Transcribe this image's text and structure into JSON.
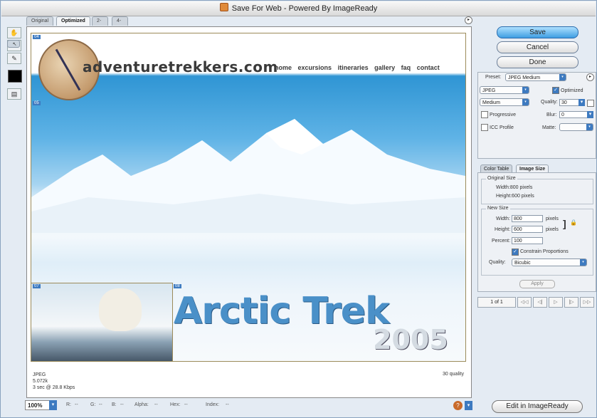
{
  "window": {
    "title": "Save For Web - Powered By ImageReady"
  },
  "view_tabs": [
    "Original",
    "Optimized",
    "2-Up",
    "4-Up"
  ],
  "active_view_tab": "Optimized",
  "tools": [
    {
      "name": "hand-tool-icon",
      "glyph": "✋"
    },
    {
      "name": "slice-select-tool-icon",
      "glyph": "↖"
    },
    {
      "name": "zoom-tool-icon",
      "glyph": "🔍"
    },
    {
      "name": "eyedropper-tool-icon",
      "glyph": "✎"
    }
  ],
  "eyedropper_color": "#000000",
  "canvas": {
    "site_name": "adventuretrekkers.com",
    "nav": [
      "home",
      "excursions",
      "itineraries",
      "gallery",
      "faq",
      "contact"
    ],
    "headline": "Arctic Trek",
    "year": "2005",
    "slice_labels": [
      "04",
      "05",
      "07",
      "08"
    ]
  },
  "doc_info": {
    "format": "JPEG",
    "size": "5.072k",
    "download_time": "3 sec @ 28.8 Kbps",
    "quality_note": "30 quality"
  },
  "statusbar": {
    "zoom": "100%",
    "r": "R:",
    "r_val": "--",
    "g": "G:",
    "g_val": "--",
    "b": "B:",
    "b_val": "--",
    "alpha": "Alpha:",
    "alpha_val": "--",
    "hex": "Hex:",
    "hex_val": "--",
    "index": "Index:",
    "index_val": "--"
  },
  "buttons": {
    "save": "Save",
    "cancel": "Cancel",
    "done": "Done",
    "edit_in_imageready": "Edit in ImageReady",
    "apply": "Apply"
  },
  "settings": {
    "preset_label": "Preset:",
    "preset_value": "JPEG Medium",
    "format_value": "JPEG",
    "optimized_label": "Optimized",
    "optimized_checked": true,
    "compression_value": "Medium",
    "quality_label": "Quality:",
    "quality_value": "30",
    "progressive_label": "Progressive",
    "progressive_checked": false,
    "blur_label": "Blur:",
    "blur_value": "0",
    "icc_label": "ICC Profile",
    "icc_checked": false,
    "matte_label": "Matte:",
    "matte_value": ""
  },
  "right_tabs": [
    "Color Table",
    "Image Size"
  ],
  "active_right_tab": "Image Size",
  "image_size": {
    "original_title": "Original Size",
    "orig_width": "Width:800 pixels",
    "orig_height": "Height:600 pixels",
    "new_title": "New Size",
    "width_label": "Width:",
    "width_value": "800",
    "height_label": "Height:",
    "height_value": "600",
    "unit": "pixels",
    "percent_label": "Percent:",
    "percent_value": "100",
    "constrain_label": "Constrain Proportions",
    "constrain_checked": true,
    "quality_label": "Quality:",
    "quality_value": "Bicubic"
  },
  "animation": {
    "frame_count": "1 of 1",
    "controls": [
      "◁◁",
      "◁|",
      "▷",
      "|▷",
      "▷▷"
    ]
  },
  "colors": {
    "accent": "#3d7ac0",
    "save_button": "#3e9ee2",
    "headline": "#4a90c8"
  }
}
